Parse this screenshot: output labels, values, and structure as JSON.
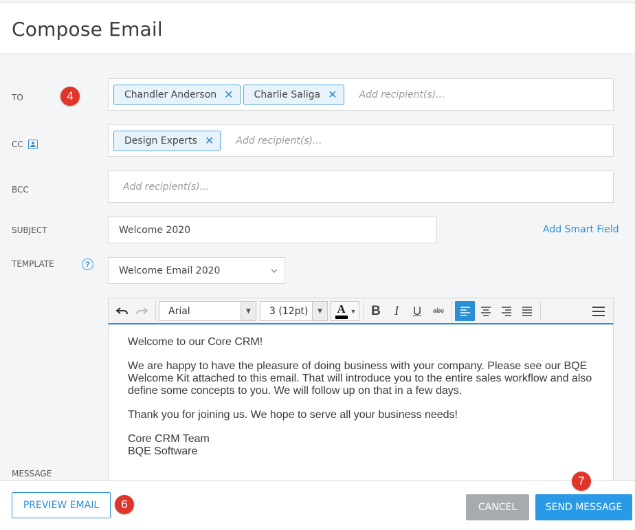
{
  "header": {
    "title": "Compose Email"
  },
  "to": {
    "label": "TO",
    "chips": [
      "Chandler Anderson",
      "Charlie Saliga"
    ],
    "placeholder": "Add recipient(s)...",
    "step_badge": "4"
  },
  "cc": {
    "label": "CC",
    "chips": [
      "Design Experts"
    ],
    "placeholder": "Add recipient(s)...",
    "icon": "contact-card-icon"
  },
  "bcc": {
    "label": "BCC",
    "placeholder": "Add recipient(s)..."
  },
  "subject": {
    "label": "SUBJECT",
    "value": "Welcome 2020",
    "smart_field_link": "Add Smart Field"
  },
  "template": {
    "label": "TEMPLATE",
    "value": "Welcome Email 2020",
    "help_icon": "?"
  },
  "toolbar": {
    "font": "Arial",
    "size": "3 (12pt)",
    "bold": "B",
    "italic": "I",
    "underline": "U",
    "strike": "abc",
    "font_color_glyph": "A"
  },
  "message": {
    "label": "MESSAGE",
    "greeting": "Welcome to our Core CRM!",
    "para1": "We are happy to have the pleasure of doing business with your company. Please see our BQE Welcome Kit attached to this email. That will introduce you to the entire sales workflow and also define some concepts to you. We will follow up on that in a few days.",
    "para2": "Thank you for joining us. We hope to serve all your business needs!",
    "sign1": "Core CRM Team",
    "sign2": "BQE Software"
  },
  "footer": {
    "preview_label": "PREVIEW EMAIL",
    "preview_badge": "6",
    "cancel_label": "CANCEL",
    "send_label": "SEND MESSAGE",
    "send_badge": "7"
  },
  "colors": {
    "accent": "#2a8fd6",
    "badge": "#e0352b",
    "cancel": "#a8abae",
    "chip_bg": "#e7f3fb"
  }
}
